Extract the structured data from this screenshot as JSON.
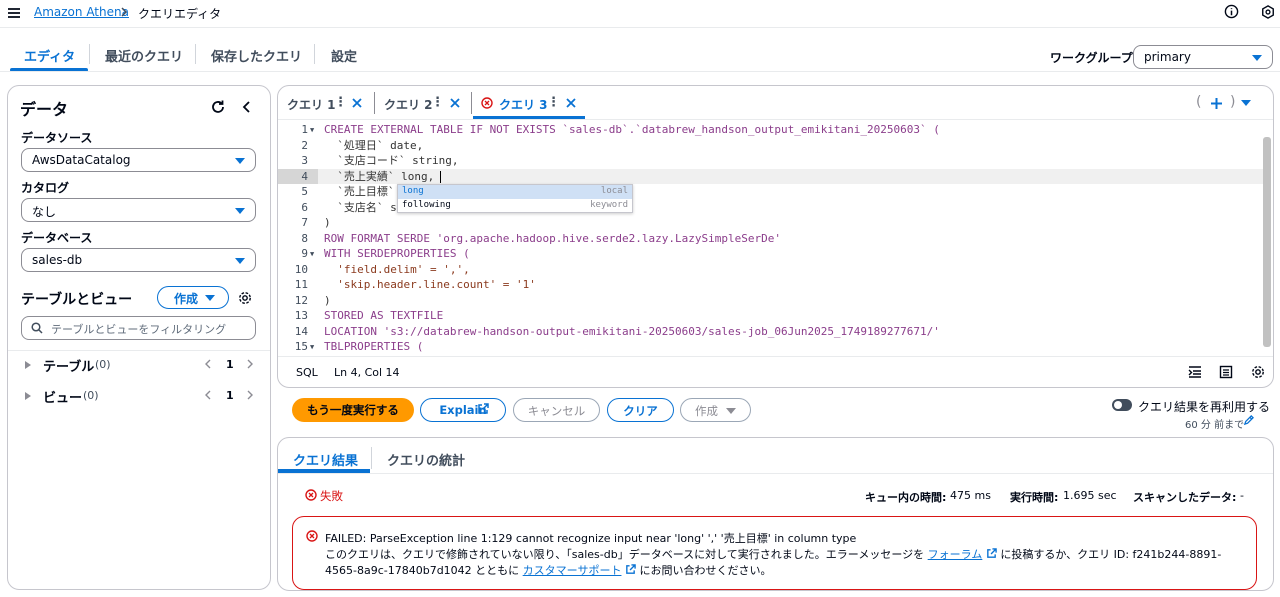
{
  "breadcrumb": {
    "service": "Amazon Athena",
    "current": "クエリエディタ"
  },
  "main_tabs": [
    "エディタ",
    "最近のクエリ",
    "保存したクエリ",
    "設定"
  ],
  "workgroup": {
    "label": "ワークグループ",
    "value": "primary"
  },
  "data_panel": {
    "title": "データ",
    "source_label": "データソース",
    "source_value": "AwsDataCatalog",
    "catalog_label": "カタログ",
    "catalog_value": "なし",
    "database_label": "データベース",
    "database_value": "sales-db",
    "tables_views_title": "テーブルとビュー",
    "create_button": "作成",
    "filter_placeholder": "テーブルとビューをフィルタリング",
    "tree": [
      {
        "label": "テーブル",
        "count": "(0)",
        "page": "1"
      },
      {
        "label": "ビュー",
        "count": "(0)",
        "page": "1"
      }
    ]
  },
  "query_tabs": [
    {
      "label": "クエリ 1",
      "error": false
    },
    {
      "label": "クエリ 2",
      "error": false
    },
    {
      "label": "クエリ 3",
      "error": true
    }
  ],
  "tab_actions": {
    "open_paren": "(",
    "close_paren": ")"
  },
  "editor": {
    "line_numbers": [
      "1",
      "2",
      "3",
      "4",
      "5",
      "6",
      "7",
      "8",
      "9",
      "10",
      "11",
      "12",
      "13",
      "14",
      "15"
    ],
    "lines": [
      "CREATE EXTERNAL TABLE IF NOT EXISTS `sales-db`.`databrew_handson_output_emikitani_20250603` (",
      "  `処理日` date,",
      "  `支店コード` string,",
      "  `売上実績` long,",
      "  `売上目標` ",
      "  `支店名` s",
      ")",
      "ROW FORMAT SERDE 'org.apache.hadoop.hive.serde2.lazy.LazySimpleSerDe'",
      "WITH SERDEPROPERTIES (",
      "  'field.delim' = ',',",
      "  'skip.header.line.count' = '1'",
      ")",
      "STORED AS TEXTFILE",
      "LOCATION 's3://databrew-handson-output-emikitani-20250603/sales-job_06Jun2025_1749189277671/'",
      "TBLPROPERTIES ("
    ],
    "autocomplete": [
      {
        "text": "long",
        "meta": "local"
      },
      {
        "text": "following",
        "meta": "keyword"
      }
    ],
    "language": "SQL",
    "position": "Ln 4, Col 14"
  },
  "actions": {
    "run_again": "もう一度実行する",
    "explain": "Explain",
    "cancel": "キャンセル",
    "clear": "クリア",
    "create": "作成",
    "reuse_label": "クエリ結果を再利用する",
    "reuse_sub": "60 分 前まで"
  },
  "results": {
    "tabs": [
      "クエリ結果",
      "クエリの統計"
    ],
    "status": "失敗",
    "queue_time_label": "キュー内の時間:",
    "queue_time": "475 ms",
    "run_time_label": "実行時間:",
    "run_time": "1.695 sec",
    "scanned_label": "スキャンしたデータ:",
    "scanned": "-",
    "error_title": "FAILED: ParseException line 1:129 cannot recognize input near 'long' ',' '売上目標' in column type",
    "error_body_1": "このクエリは、クエリで修飾されていない限り、「sales-db」データベースに対して実行されました。エラーメッセージを",
    "error_link_forum": "フォーラム",
    "error_body_2": "に投稿するか、クエリ ID: f241b244-8891-4565-8a9c-17840b7d1042 とともに",
    "error_link_support": "カスタマーサポート",
    "error_body_3": "にお問い合わせください。"
  },
  "colors": {
    "accent": "#0972d3",
    "run": "#ff9900",
    "error": "#d91515"
  }
}
